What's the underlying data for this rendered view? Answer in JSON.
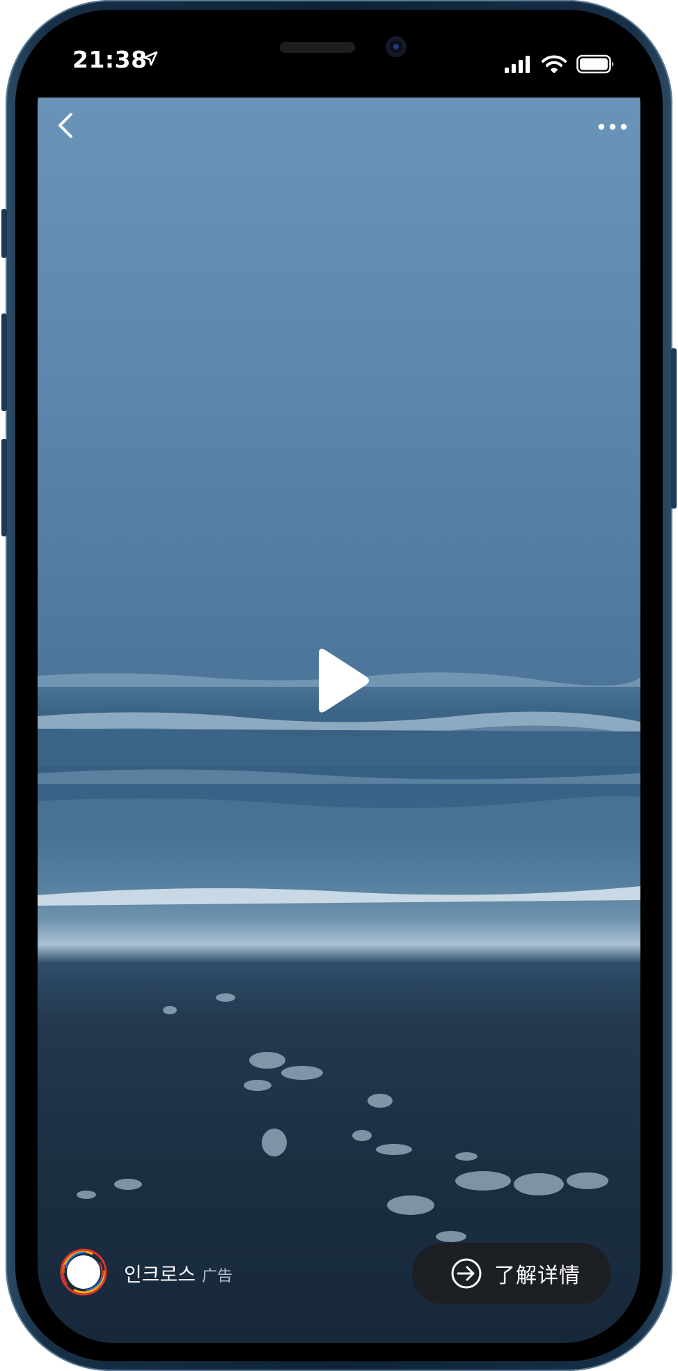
{
  "status_bar": {
    "time": "21:38",
    "icons": [
      "location-arrow-icon",
      "cellular-signal-icon",
      "wifi-icon",
      "battery-icon"
    ]
  },
  "top_controls": {
    "back_icon": "chevron-left-icon",
    "more_icon": "more-horizontal-icon"
  },
  "video": {
    "play_icon": "play-icon"
  },
  "ad": {
    "account_name": "인크로스",
    "ad_label": "广告",
    "cta_label": "了解详情",
    "cta_icon": "arrow-right-circle-icon"
  },
  "colors": {
    "sky": "#5f89b0",
    "sea": "#355d80",
    "sand": "#1c2f43",
    "cta_background": "#1c1f24",
    "phone_frame": "#0e2236"
  }
}
